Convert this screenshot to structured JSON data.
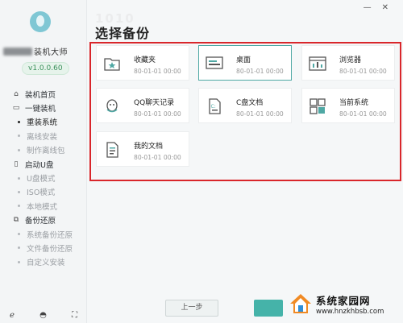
{
  "sidebar": {
    "brand_suffix": "装机大师",
    "version": "v1.0.0.60",
    "items": [
      {
        "label": "装机首页",
        "type": "top",
        "icon": "home-icon",
        "glyph": "⌂"
      },
      {
        "label": "一键装机",
        "type": "top",
        "icon": "monitor-icon",
        "glyph": "▭"
      },
      {
        "label": "重装系统",
        "type": "sub",
        "active": true
      },
      {
        "label": "离线安装",
        "type": "sub"
      },
      {
        "label": "制作离线包",
        "type": "sub"
      },
      {
        "label": "启动U盘",
        "type": "top",
        "icon": "usb-icon",
        "glyph": "▯"
      },
      {
        "label": "U盘模式",
        "type": "sub"
      },
      {
        "label": "ISO模式",
        "type": "sub"
      },
      {
        "label": "本地模式",
        "type": "sub"
      },
      {
        "label": "备份还原",
        "type": "top",
        "icon": "backup-icon",
        "glyph": "⧉"
      },
      {
        "label": "系统备份还原",
        "type": "sub"
      },
      {
        "label": "文件备份还原",
        "type": "sub"
      },
      {
        "label": "自定义安装",
        "type": "sub"
      }
    ]
  },
  "window": {
    "minimize": "—",
    "close": "✕"
  },
  "header": {
    "title": "选择备份",
    "ghost": "1010"
  },
  "cards": [
    {
      "name": "收藏夹",
      "time": "80-01-01 00:00",
      "icon": "favorites-icon",
      "selected": false
    },
    {
      "name": "桌面",
      "time": "80-01-01 00:00",
      "icon": "desktop-icon",
      "selected": true
    },
    {
      "name": "浏览器",
      "time": "80-01-01 00:00",
      "icon": "browser-icon",
      "selected": false
    },
    {
      "name": "QQ聊天记录",
      "time": "80-01-01 00:00",
      "icon": "qq-icon",
      "selected": false
    },
    {
      "name": "C盘文档",
      "time": "80-01-01 00:00",
      "icon": "c-drive-doc-icon",
      "selected": false
    },
    {
      "name": "当前系统",
      "time": "80-01-01 00:00",
      "icon": "windows-icon",
      "selected": false
    },
    {
      "name": "我的文档",
      "time": "80-01-01 00:00",
      "icon": "document-icon",
      "selected": false
    }
  ],
  "footer": {
    "prev_label": "上一步"
  },
  "watermark": {
    "name": "系统家园网",
    "url": "www.hnzkhbsb.com"
  },
  "colors": {
    "accent": "#45b3a9",
    "highlight_border": "#d9262b",
    "brand_green": "#3a8f5a"
  }
}
